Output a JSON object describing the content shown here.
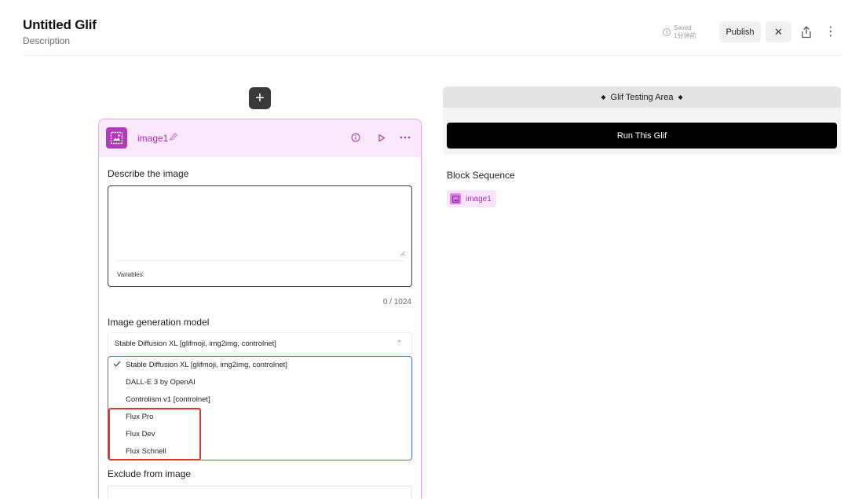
{
  "header": {
    "title": "Untitled Glif",
    "subtitle": "Description",
    "saved_label": "Saved",
    "saved_time": "1分钟前",
    "publish_label": "Publish",
    "close_label": "✕",
    "more_label": "⋮"
  },
  "add_button": {
    "label": "+"
  },
  "block": {
    "name": "image1",
    "prompt_label": "Describe the image",
    "prompt_value": "",
    "variables_label": "Variables:",
    "char_count": "0 / 1024",
    "model_label": "Image generation model",
    "model_selected": "Stable Diffusion XL [glifmoji, img2img, controlnet]",
    "model_options": [
      "Stable Diffusion XL [glifmoji, img2img, controlnet]",
      "DALL-E 3 by OpenAI",
      "Controlism v1 [controlnet]",
      "Flux Pro",
      "Flux Dev",
      "Flux Schnell"
    ],
    "exclude_label": "Exclude from image"
  },
  "testing": {
    "title": "Glif Testing Area",
    "run_label": "Run This Glif",
    "sequence_title": "Block Sequence",
    "sequence_items": [
      "image1"
    ]
  },
  "colors": {
    "accent": "#b03aba",
    "block_header_bg": "#fbe8fd",
    "block_border": "#e2a3ee",
    "dropdown_border": "#4a6fd1",
    "highlight": "#d93a2b"
  }
}
